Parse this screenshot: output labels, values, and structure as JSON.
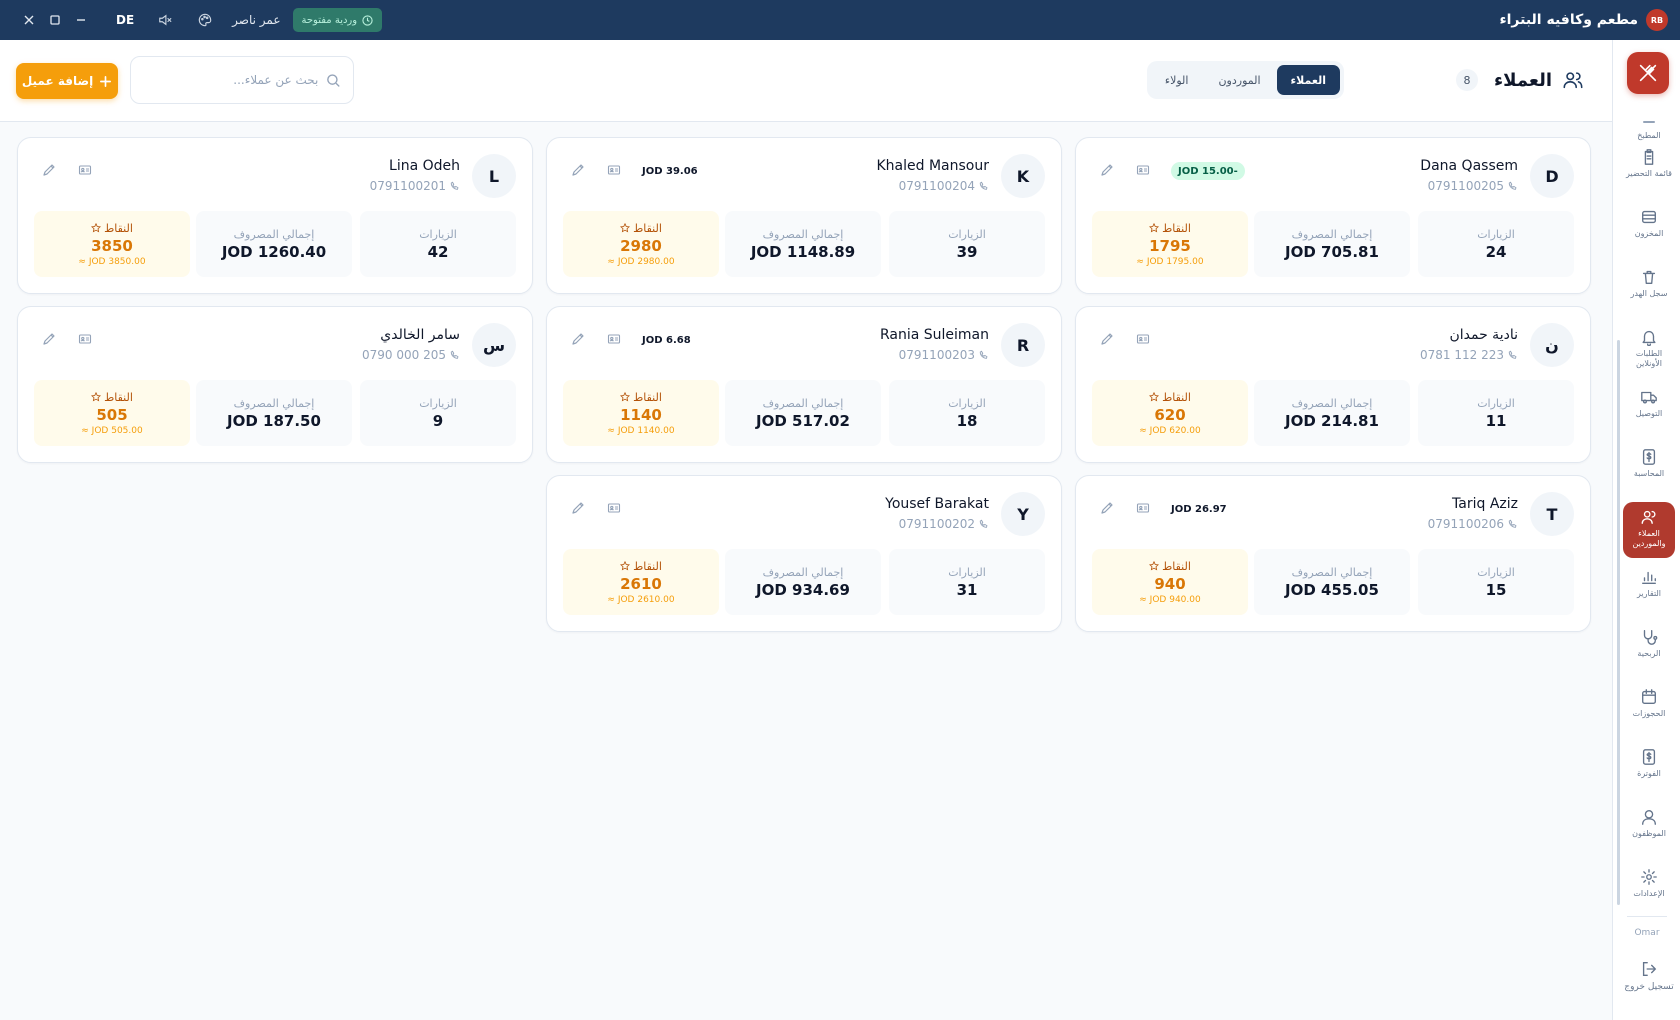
{
  "titlebar": {
    "app_title": "مطعم وكافيه البتراء",
    "logo_text": "RB",
    "shift_label": "وردية مفتوحة",
    "user_name": "عمر ناصر",
    "language": "DE"
  },
  "sidebar": {
    "partial_item_label": "المطبخ",
    "items": [
      {
        "label": "قائمة التحضير",
        "icon": "clipboard-icon"
      },
      {
        "label": "المخزون",
        "icon": "inventory-icon"
      },
      {
        "label": "سجل الهدر",
        "icon": "trash-icon"
      },
      {
        "label": "الطلبات الأونلاين",
        "icon": "bell-icon"
      },
      {
        "label": "التوصيل",
        "icon": "truck-icon"
      },
      {
        "label": "المحاسبة",
        "icon": "dollar-icon"
      },
      {
        "label": "العملاء والموردين",
        "icon": "users-icon",
        "active": true
      },
      {
        "label": "التقارير",
        "icon": "bar-chart-icon"
      },
      {
        "label": "الربحية",
        "icon": "stethoscope-icon"
      },
      {
        "label": "الحجوزات",
        "icon": "calendar-icon"
      },
      {
        "label": "الفوترة",
        "icon": "invoice-icon"
      },
      {
        "label": "الموظفون",
        "icon": "user-icon"
      },
      {
        "label": "الإعدادات",
        "icon": "gear-icon"
      }
    ],
    "current_user": "Omar",
    "logout_label": "تسجيل خروج"
  },
  "header": {
    "title": "العملاء",
    "count": "8",
    "tabs": [
      "العملاء",
      "الموردون",
      "الولاء"
    ],
    "active_tab": 0,
    "search_placeholder": "بحث عن عملاء...",
    "add_button_label": "إضافة عميل"
  },
  "labels": {
    "visits": "الزيارات",
    "total_spent": "إجمالي المصروف",
    "points": "النقاط"
  },
  "customers": [
    {
      "initial": "D",
      "name": "Dana Qassem",
      "phone": "0791100205",
      "balance": "JOD 15.00-",
      "balance_type": "credit",
      "visits": "24",
      "total_spent": "JOD 705.81",
      "points": "1795",
      "points_value": "≈ JOD 1795.00"
    },
    {
      "initial": "K",
      "name": "Khaled Mansour",
      "phone": "0791100204",
      "balance": "JOD 39.06",
      "balance_type": "due",
      "visits": "39",
      "total_spent": "JOD 1148.89",
      "points": "2980",
      "points_value": "≈ JOD 2980.00"
    },
    {
      "initial": "L",
      "name": "Lina Odeh",
      "phone": "0791100201",
      "balance": "",
      "balance_type": "",
      "visits": "42",
      "total_spent": "JOD 1260.40",
      "points": "3850",
      "points_value": "≈ JOD 3850.00"
    },
    {
      "initial": "ن",
      "name": "نادية حمدان",
      "phone": "0781 112 223",
      "balance": "",
      "balance_type": "",
      "visits": "11",
      "total_spent": "JOD 214.81",
      "points": "620",
      "points_value": "≈ JOD 620.00"
    },
    {
      "initial": "R",
      "name": "Rania Suleiman",
      "phone": "0791100203",
      "balance": "JOD 6.68",
      "balance_type": "due",
      "visits": "18",
      "total_spent": "JOD 517.02",
      "points": "1140",
      "points_value": "≈ JOD 1140.00"
    },
    {
      "initial": "س",
      "name": "سامر الخالدي",
      "phone": "0790 000 205",
      "balance": "",
      "balance_type": "",
      "visits": "9",
      "total_spent": "JOD 187.50",
      "points": "505",
      "points_value": "≈ JOD 505.00"
    },
    {
      "initial": "T",
      "name": "Tariq Aziz",
      "phone": "0791100206",
      "balance": "JOD 26.97",
      "balance_type": "due",
      "visits": "15",
      "total_spent": "JOD 455.05",
      "points": "940",
      "points_value": "≈ JOD 940.00"
    },
    {
      "initial": "Y",
      "name": "Yousef Barakat",
      "phone": "0791100202",
      "balance": "",
      "balance_type": "",
      "visits": "31",
      "total_spent": "JOD 934.69",
      "points": "2610",
      "points_value": "≈ JOD 2610.00"
    }
  ]
}
